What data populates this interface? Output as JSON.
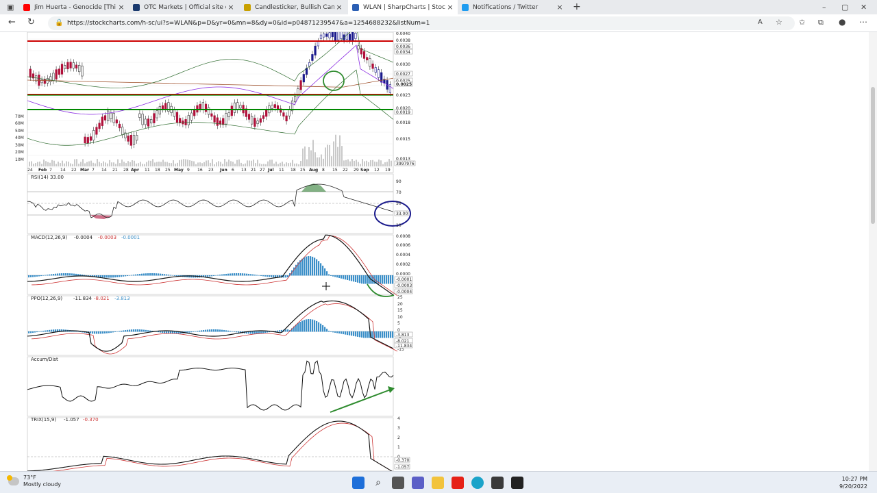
{
  "tabs": [
    {
      "title": "Jim Huerta - Genocide [Thi",
      "active": false,
      "favicon_color": "#ff0000",
      "icon": "youtube-icon"
    },
    {
      "title": "OTC Markets | Official site of OTC",
      "active": false,
      "favicon_color": "#1a3a6e",
      "icon": "otc-icon"
    },
    {
      "title": "Candlesticker, Bullish Candlestic",
      "active": false,
      "favicon_color": "#c8a000",
      "icon": "candlesticker-icon"
    },
    {
      "title": "WLAN | SharpCharts | StockChar",
      "active": true,
      "favicon_color": "#2b5fb4",
      "icon": "stockcharts-icon"
    },
    {
      "title": "Notifications / Twitter",
      "active": false,
      "favicon_color": "#1d9bf0",
      "icon": "twitter-icon"
    }
  ],
  "address_bar": {
    "url": "https://stockcharts.com/h-sc/ui?s=WLAN&p=D&yr=0&mn=8&dy=0&id=p04871239547&a=1254688232&listNum=1"
  },
  "main_chart": {
    "price_labels": [
      "0.0040",
      "0.0038",
      "0.0036",
      "0.0034",
      "0.0030",
      "0.0027",
      "0.0025",
      "0.0025",
      "0.0023",
      "0.0020",
      "0.0019",
      "0.0018",
      "0.0015",
      "0.0013"
    ],
    "volume_axis_labels": [
      "70M",
      "60M",
      "50M",
      "40M",
      "30M",
      "20M",
      "10M"
    ],
    "volume_value_label": "3997976",
    "date_labels": [
      "24",
      "Feb",
      "7",
      "14",
      "22",
      "Mar",
      "7",
      "14",
      "21",
      "28",
      "Apr",
      "11",
      "18",
      "25",
      "May",
      "9",
      "16",
      "23",
      "Jun",
      "6",
      "13",
      "21",
      "27",
      "Jul",
      "11",
      "18",
      "25",
      "Aug",
      "8",
      "15",
      "22",
      "29",
      "Sep",
      "12",
      "19"
    ]
  },
  "rsi_panel": {
    "label": "RSI(14) 33.00",
    "axis_labels": [
      "90",
      "70",
      "50",
      "30",
      "10"
    ],
    "value_label": "33.00"
  },
  "macd_panel": {
    "label": "MACD(12,26,9)",
    "value_main": "-0.0004",
    "value_signal": "-0.0003",
    "value_hist": "-0.0001",
    "axis_labels": [
      "0.0008",
      "0.0006",
      "0.0004",
      "0.0002",
      "0.0000"
    ],
    "value_labels": [
      "-0.0001",
      "-0.0003",
      "-0.0004"
    ]
  },
  "ppo_panel": {
    "label": "PPO(12,26,9)",
    "value_main": "-11.834",
    "value_signal": "-8.021",
    "value_hist": "-3.813",
    "axis_labels": [
      "25",
      "20",
      "15",
      "10",
      "5",
      "0",
      "-5",
      "-15"
    ],
    "value_labels": [
      "-3.813",
      "-8.021",
      "-11.834"
    ]
  },
  "accum_panel": {
    "label": "Accum/Dist"
  },
  "trix_panel": {
    "label": "TRIX(15,9)",
    "value_main": "-1.057",
    "value_signal": "-0.370",
    "axis_labels": [
      "4",
      "3",
      "2",
      "1",
      "0"
    ],
    "value_labels": [
      "-0.370",
      "-1.057"
    ]
  },
  "colors": {
    "resistance_line": "#cc0000",
    "support_line": "#008800",
    "annotation_blue": "#1a1a8c",
    "annotation_green": "#2e8b2e",
    "macd_hist": "#3b8fc8",
    "rsi_fill": "#2e7d32"
  },
  "taskbar": {
    "temperature": "73°F",
    "weather": "Mostly cloudy",
    "time": "10:27 PM",
    "date": "9/20/2022"
  }
}
